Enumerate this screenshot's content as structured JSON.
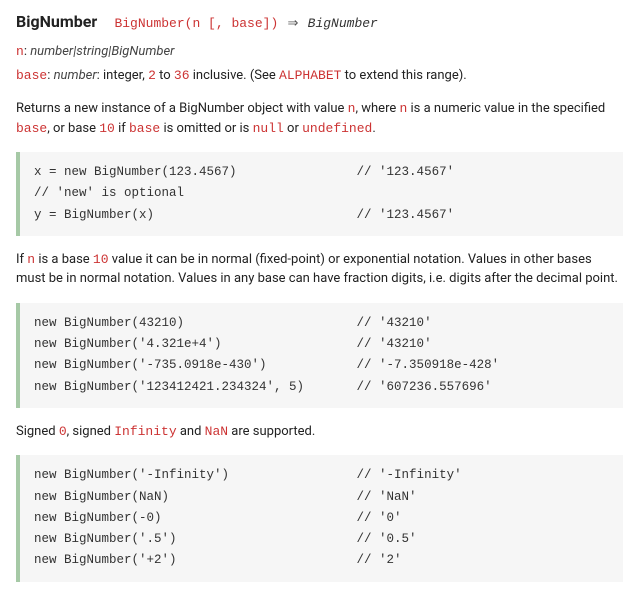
{
  "header": {
    "title": "BigNumber",
    "signature": "BigNumber(n [, base])",
    "arrow": "⇒",
    "returns": "BigNumber"
  },
  "params": {
    "n_name": "n",
    "n_sep": ": ",
    "n_type": "number|string|BigNumber",
    "base_name": "base",
    "base_sep": ": ",
    "base_type": "number",
    "base_desc1": ": integer, ",
    "base_min": "2",
    "base_desc2": " to ",
    "base_max": "36",
    "base_desc3": " inclusive. (See ",
    "base_link": "ALPHABET",
    "base_desc4": " to extend this range)."
  },
  "para1": {
    "t1": "Returns a new instance of a BigNumber object with value ",
    "c1": "n",
    "t2": ", where ",
    "c2": "n",
    "t3": " is a numeric value in the specified ",
    "c3": "base",
    "t4": ", or base ",
    "c4": "10",
    "t5": " if ",
    "c5": "base",
    "t6": " is omitted or is ",
    "c6": "null",
    "t7": " or ",
    "c7": "undefined",
    "t8": "."
  },
  "code1": "x = new BigNumber(123.4567)                // '123.4567'\n// 'new' is optional\ny = BigNumber(x)                           // '123.4567'",
  "para2": {
    "t1": "If ",
    "c1": "n",
    "t2": " is a base ",
    "c2": "10",
    "t3": " value it can be in normal (fixed-point) or exponential notation. Values in other bases must be in normal notation. Values in any base can have fraction digits, i.e. digits after the decimal point."
  },
  "code2": "new BigNumber(43210)                       // '43210'\nnew BigNumber('4.321e+4')                  // '43210'\nnew BigNumber('-735.0918e-430')            // '-7.350918e-428'\nnew BigNumber('123412421.234324', 5)       // '607236.557696'",
  "para3": {
    "t1": "Signed ",
    "c1": "0",
    "t2": ", signed ",
    "c2": "Infinity",
    "t3": " and ",
    "c3": "NaN",
    "t4": " are supported."
  },
  "code3": "new BigNumber('-Infinity')                 // '-Infinity'\nnew BigNumber(NaN)                         // 'NaN'\nnew BigNumber(-0)                          // '0'\nnew BigNumber('.5')                        // '0.5'\nnew BigNumber('+2')                        // '2'"
}
